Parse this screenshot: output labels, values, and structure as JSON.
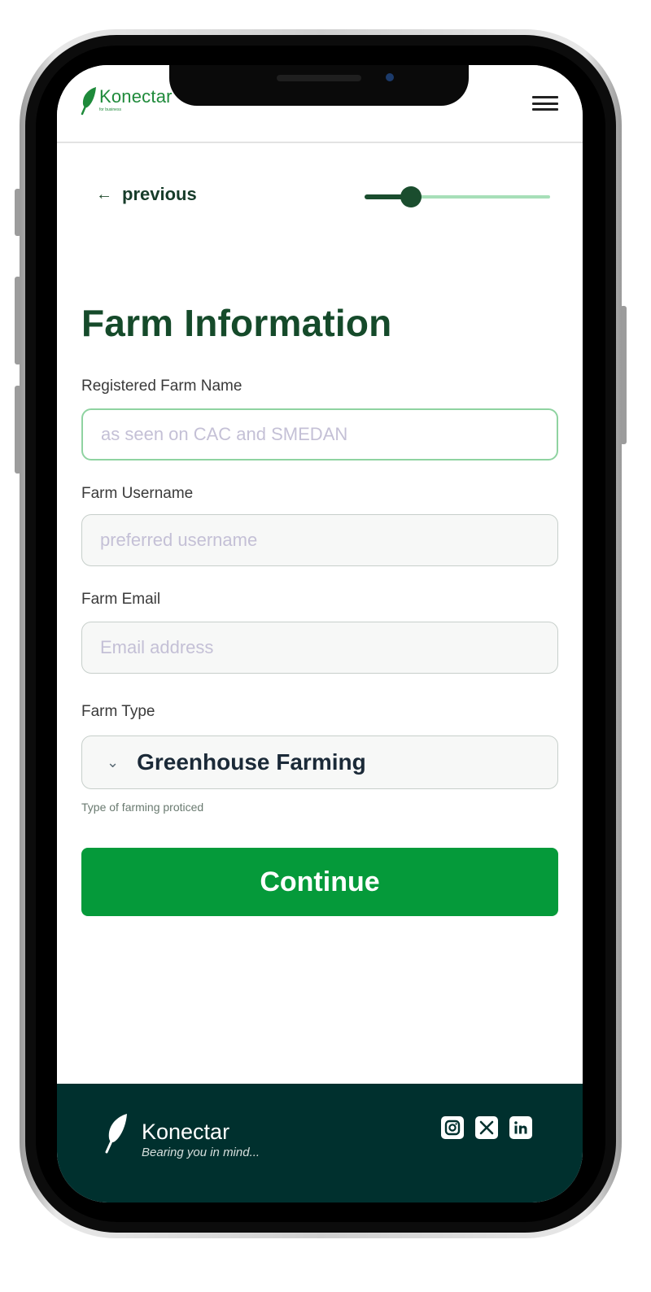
{
  "header": {
    "logo_text": "Konectar",
    "logo_sub": "for business"
  },
  "nav": {
    "previous_label": "previous",
    "progress": 0.25
  },
  "form": {
    "title": "Farm Information",
    "fields": [
      {
        "label": "Registered Farm Name",
        "placeholder": "as seen on CAC and SMEDAN",
        "value": ""
      },
      {
        "label": "Farm Username",
        "placeholder": "preferred username",
        "value": ""
      },
      {
        "label": "Farm Email",
        "placeholder": "Email address",
        "value": ""
      }
    ],
    "farm_type": {
      "label": "Farm Type",
      "selected": "Greenhouse Farming",
      "helper": "Type of farming proticed"
    },
    "continue_label": "Continue"
  },
  "footer": {
    "brand": "Konectar",
    "tagline": "Bearing you in mind...",
    "socials": [
      "instagram-icon",
      "x-icon",
      "linkedin-icon"
    ]
  },
  "colors": {
    "primary_green": "#059a3a",
    "dark_green": "#154a2a",
    "footer_bg": "#00302e",
    "focus_border": "#8fd3a1"
  }
}
